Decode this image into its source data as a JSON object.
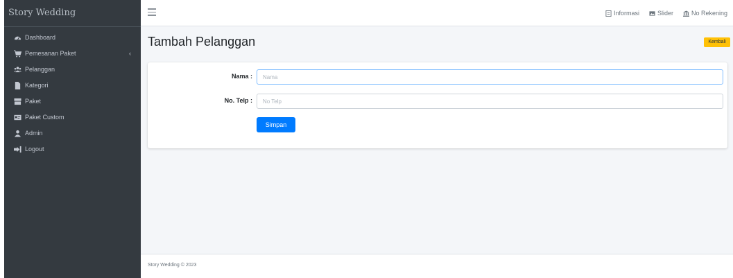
{
  "brand": "Story Wedding",
  "sidebar": {
    "items": [
      {
        "label": "Dashboard",
        "icon": "tachometer-icon"
      },
      {
        "label": "Pemesanan Paket",
        "icon": "shopping-cart-icon",
        "has_submenu": true
      },
      {
        "label": "Pelanggan",
        "icon": "users-icon"
      },
      {
        "label": "Kategori",
        "icon": "file-icon"
      },
      {
        "label": "Paket",
        "icon": "box-icon"
      },
      {
        "label": "Paket Custom",
        "icon": "id-card-icon"
      },
      {
        "label": "Admin",
        "icon": "user-icon"
      },
      {
        "label": "Logout",
        "icon": "sign-out-icon"
      }
    ]
  },
  "topbar": {
    "links": [
      {
        "label": "Informasi",
        "icon": "info-icon"
      },
      {
        "label": "Slider",
        "icon": "image-icon"
      },
      {
        "label": "No Rekening",
        "icon": "bank-icon"
      }
    ]
  },
  "page": {
    "title": "Tambah Pelanggan",
    "back_label": "Kembali"
  },
  "form": {
    "name_label": "Nama :",
    "name_placeholder": "Nama",
    "name_value": "",
    "phone_label": "No. Telp :",
    "phone_placeholder": "No Telp",
    "phone_value": "",
    "submit_label": "Simpan"
  },
  "footer": {
    "text": "Story Wedding © 2023"
  },
  "colors": {
    "sidebar_bg": "#343a40",
    "content_bg": "#f4f6f9",
    "primary": "#007bff",
    "warning": "#ffc107"
  }
}
